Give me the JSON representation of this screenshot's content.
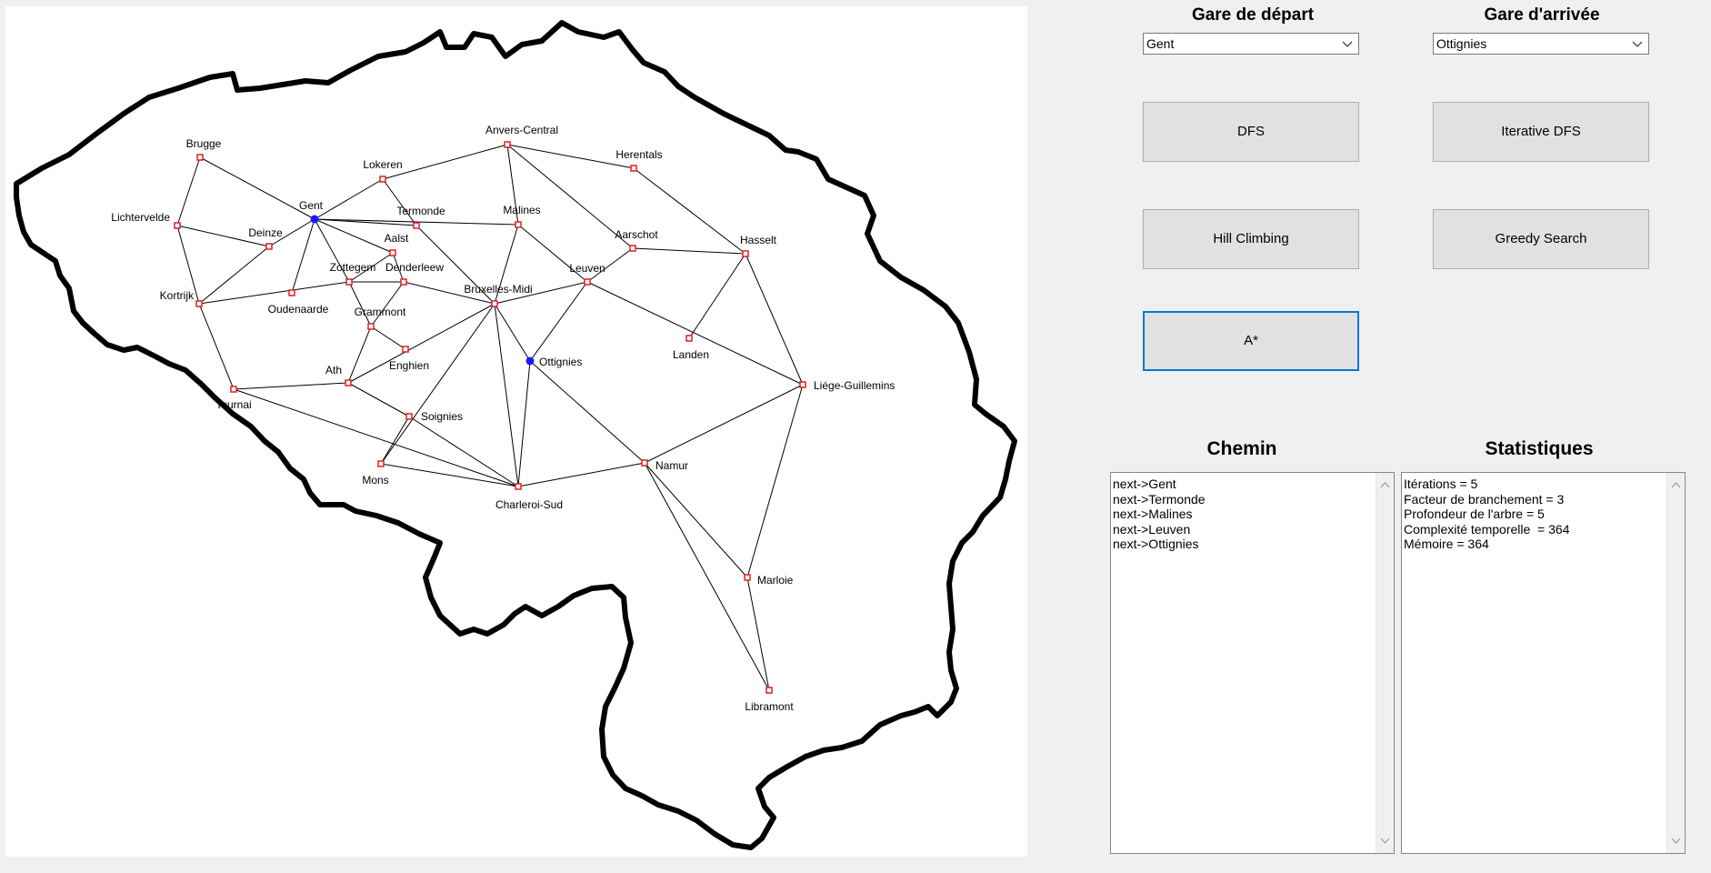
{
  "colors": {
    "edge": "#000000",
    "station": "#e02020",
    "selected": "#1a1aff",
    "border": "#000000",
    "focus": "#0078d7"
  },
  "labels": {
    "departure_title": "Gare de départ",
    "arrival_title": "Gare d'arrivée",
    "path_title": "Chemin",
    "stats_title": "Statistiques"
  },
  "departure": {
    "selected": "Gent"
  },
  "arrival": {
    "selected": "Ottignies"
  },
  "buttons": {
    "dfs": "DFS",
    "iterative_dfs": "Iterative DFS",
    "hill_climbing": "Hill Climbing",
    "greedy_search": "Greedy Search",
    "astar": "A*"
  },
  "path": [
    "next->Gent",
    "next->Termonde",
    "next->Malines",
    "next->Leuven",
    "next->Ottignies"
  ],
  "stats": [
    "Itérations = 5",
    "Facteur de branchement = 3",
    "Profondeur de l'arbre = 5",
    "Complexité temporelle  = 364",
    "Mémoire = 364"
  ],
  "map": {
    "stations": [
      {
        "id": "brugge",
        "name": "Brugge",
        "selected": false
      },
      {
        "id": "gent",
        "name": "Gent",
        "selected": true
      },
      {
        "id": "lokeren",
        "name": "Lokeren",
        "selected": false
      },
      {
        "id": "anvers",
        "name": "Anvers-Central",
        "selected": false
      },
      {
        "id": "herentals",
        "name": "Herentals",
        "selected": false
      },
      {
        "id": "lichtervelde",
        "name": "Lichtervelde",
        "selected": false
      },
      {
        "id": "deinze",
        "name": "Deinze",
        "selected": false
      },
      {
        "id": "termonde",
        "name": "Termonde",
        "selected": false
      },
      {
        "id": "malines",
        "name": "Malines",
        "selected": false
      },
      {
        "id": "aarschot",
        "name": "Aarschot",
        "selected": false
      },
      {
        "id": "hasselt",
        "name": "Hasselt",
        "selected": false
      },
      {
        "id": "aalst",
        "name": "Aalst",
        "selected": false
      },
      {
        "id": "zottegem",
        "name": "Zottegem",
        "selected": false
      },
      {
        "id": "denderleeuw",
        "name": "Denderleew",
        "selected": false
      },
      {
        "id": "leuven",
        "name": "Leuven",
        "selected": false
      },
      {
        "id": "kortrijk",
        "name": "Kortrijk",
        "selected": false
      },
      {
        "id": "oudenaarde",
        "name": "Oudenaarde",
        "selected": false
      },
      {
        "id": "bruxelles",
        "name": "Bruxelles-Midi",
        "selected": false
      },
      {
        "id": "grammont",
        "name": "Grammont",
        "selected": false
      },
      {
        "id": "enghien",
        "name": "Enghien",
        "selected": false
      },
      {
        "id": "ottignies",
        "name": "Ottignies",
        "selected": true
      },
      {
        "id": "landen",
        "name": "Landen",
        "selected": false
      },
      {
        "id": "ath",
        "name": "Ath",
        "selected": false
      },
      {
        "id": "liege",
        "name": "Liége-Guillemins",
        "selected": false
      },
      {
        "id": "tournai",
        "name": "Tournai",
        "selected": false
      },
      {
        "id": "soignies",
        "name": "Soignies",
        "selected": false
      },
      {
        "id": "mons",
        "name": "Mons",
        "selected": false
      },
      {
        "id": "charleroi",
        "name": "Charleroi-Sud",
        "selected": false
      },
      {
        "id": "namur",
        "name": "Namur",
        "selected": false
      },
      {
        "id": "marloie",
        "name": "Marloie",
        "selected": false
      },
      {
        "id": "libramont",
        "name": "Libramont",
        "selected": false
      }
    ],
    "connections": [
      [
        "brugge",
        "gent"
      ],
      [
        "brugge",
        "lichtervelde"
      ],
      [
        "lichtervelde",
        "deinze"
      ],
      [
        "lichtervelde",
        "kortrijk"
      ],
      [
        "deinze",
        "gent"
      ],
      [
        "deinze",
        "kortrijk"
      ],
      [
        "gent",
        "lokeren"
      ],
      [
        "gent",
        "termonde"
      ],
      [
        "gent",
        "malines"
      ],
      [
        "gent",
        "aalst"
      ],
      [
        "gent",
        "zottegem"
      ],
      [
        "gent",
        "oudenaarde"
      ],
      [
        "lokeren",
        "anvers"
      ],
      [
        "lokeren",
        "termonde"
      ],
      [
        "anvers",
        "herentals"
      ],
      [
        "anvers",
        "malines"
      ],
      [
        "anvers",
        "aarschot"
      ],
      [
        "herentals",
        "hasselt"
      ],
      [
        "termonde",
        "bruxelles"
      ],
      [
        "malines",
        "bruxelles"
      ],
      [
        "malines",
        "leuven"
      ],
      [
        "aarschot",
        "leuven"
      ],
      [
        "aarschot",
        "hasselt"
      ],
      [
        "aalst",
        "zottegem"
      ],
      [
        "aalst",
        "denderleeuw"
      ],
      [
        "zottegem",
        "kortrijk"
      ],
      [
        "zottegem",
        "denderleeuw"
      ],
      [
        "zottegem",
        "grammont"
      ],
      [
        "denderleeuw",
        "bruxelles"
      ],
      [
        "denderleeuw",
        "grammont"
      ],
      [
        "grammont",
        "enghien"
      ],
      [
        "grammont",
        "ath"
      ],
      [
        "bruxelles",
        "leuven"
      ],
      [
        "bruxelles",
        "ath"
      ],
      [
        "bruxelles",
        "mons"
      ],
      [
        "bruxelles",
        "charleroi"
      ],
      [
        "bruxelles",
        "ottignies"
      ],
      [
        "leuven",
        "ottignies"
      ],
      [
        "leuven",
        "liege"
      ],
      [
        "hasselt",
        "landen"
      ],
      [
        "hasselt",
        "liege"
      ],
      [
        "kortrijk",
        "tournai"
      ],
      [
        "tournai",
        "ath"
      ],
      [
        "tournai",
        "charleroi"
      ],
      [
        "ath",
        "soignies"
      ],
      [
        "soignies",
        "mons"
      ],
      [
        "soignies",
        "charleroi"
      ],
      [
        "mons",
        "charleroi"
      ],
      [
        "ottignies",
        "charleroi"
      ],
      [
        "ottignies",
        "namur"
      ],
      [
        "charleroi",
        "namur"
      ],
      [
        "namur",
        "liege"
      ],
      [
        "namur",
        "libramont"
      ],
      [
        "namur",
        "marloie"
      ],
      [
        "liege",
        "marloie"
      ],
      [
        "marloie",
        "libramont"
      ]
    ]
  }
}
